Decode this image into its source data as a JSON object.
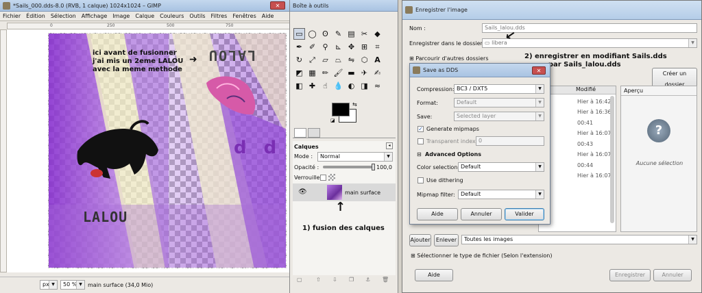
{
  "gimp": {
    "title": "*Sails_000.dds-8.0 (RVB, 1 calque) 1024x1024 – GIMP",
    "menu": [
      "Fichier",
      "Édition",
      "Sélection",
      "Affichage",
      "Image",
      "Calque",
      "Couleurs",
      "Outils",
      "Filtres",
      "Fenêtres",
      "Aide"
    ],
    "status": {
      "unit": "px",
      "zoom": "50 %",
      "layer_info": "main surface  (34,0 Mio)"
    },
    "ruler_marks": [
      "0",
      "250",
      "500",
      "750"
    ],
    "canvas": {
      "annotation1": "ici avant de fusionner\nj'ai mis un 2eme LALOU\navec la meme methode",
      "lalou": "LALOU",
      "lalou_mirror": "LALOU",
      "dd": "d d"
    }
  },
  "toolbox": {
    "title": "Boîte à outils",
    "layers": {
      "title": "Calques",
      "mode_label": "Mode :",
      "mode_value": "Normal",
      "opacity_label": "Opacité :",
      "opacity_value": "100,0",
      "lock_label": "Verrouiller :",
      "layer_name": "main surface"
    },
    "annotation": "1) fusion des calques"
  },
  "save_dialog": {
    "title": "Enregistrer l'image",
    "name_label": "Nom :",
    "name_value": "Sails_lalou.dds",
    "folder_label": "Enregistrer dans le dossier :",
    "folder_value": "libera",
    "browse": "Parcourir d'autres dossiers",
    "create_folder": "Créer un dossier",
    "modified_header": "Modifié",
    "preview_header": "Aperçu",
    "preview_none": "Aucune sélection",
    "modified_rows": [
      "Hier à 16:42",
      "Hier à 16:36",
      "00:41",
      "Hier à 16:07",
      "00:43",
      "Hier à 16:07",
      "00:44",
      "Hier à 16:07"
    ],
    "add": "Ajouter",
    "remove": "Enlever",
    "filter": "Toutes les images",
    "file_type": "Sélectionner le type de fichier (Selon l'extension)",
    "help": "Aide",
    "save": "Enregistrer",
    "cancel": "Annuler",
    "annotation": "2) enregistrer en modifiant Sails.dds\n          par Sails_lalou.dds"
  },
  "dds_dialog": {
    "title": "Save as DDS",
    "compression_label": "Compression:",
    "compression_value": "BC3 / DXT5",
    "format_label": "Format:",
    "format_value": "Default",
    "save_label": "Save:",
    "save_value": "Selected layer",
    "generate_mipmaps": "Generate mipmaps",
    "transparent_index": "Transparent index:",
    "transparent_value": "0",
    "advanced": "Advanced Options",
    "color_selection_label": "Color selection:",
    "color_selection_value": "Default",
    "use_dithering": "Use dithering",
    "mipmap_filter_label": "Mipmap filter:",
    "mipmap_filter_value": "Default",
    "help": "Aide",
    "cancel": "Annuler",
    "ok": "Valider"
  },
  "colors": {
    "purple": "#8e3ad6",
    "title_blue": "#b9cfe9"
  }
}
